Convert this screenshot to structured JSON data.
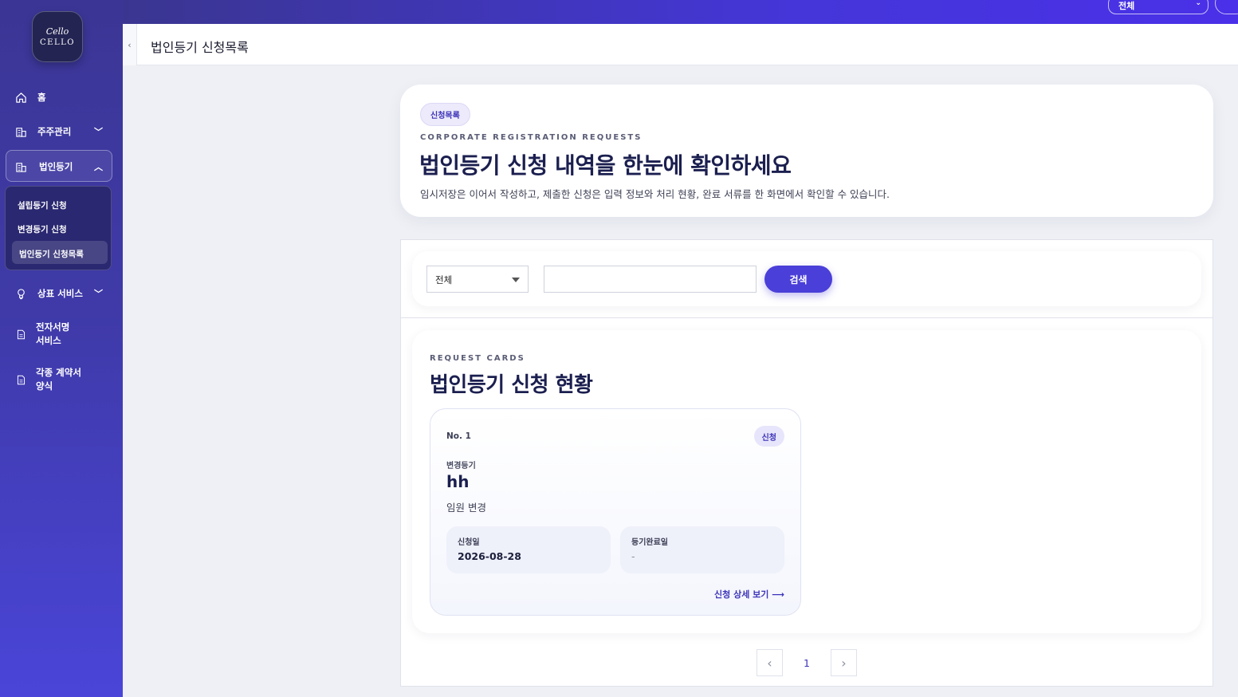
{
  "logo": {
    "mark": "Cello",
    "word": "CELLO"
  },
  "sidebar": {
    "items": [
      {
        "label": "홈",
        "icon": "home-icon"
      },
      {
        "label": "주주관리",
        "icon": "building-icon",
        "chevron": "﹀"
      },
      {
        "label": "법인등기",
        "icon": "building-icon",
        "chevron": "︿"
      },
      {
        "label": "상표 서비스",
        "icon": "lightbulb-icon",
        "chevron": "﹀"
      },
      {
        "label": "전자서명\n서비스",
        "icon": "document-icon"
      },
      {
        "label": "각종 계약서\n양식",
        "icon": "document-icon"
      }
    ],
    "submenu": [
      {
        "label": "설립등기 신청"
      },
      {
        "label": "변경등기 신청"
      },
      {
        "label": "법인등기 신청목록"
      }
    ]
  },
  "topbar": {
    "select_value": "전체"
  },
  "header": {
    "collapse": "‹",
    "title": "법인등기 신청목록"
  },
  "hero": {
    "pill": "신청목록",
    "eyebrow": "CORPORATE REGISTRATION REQUESTS",
    "title": "법인등기 신청 내역을 한눈에 확인하세요",
    "desc": "임시저장은 이어서 작성하고, 제출한 신청은 입력 정보와 처리 현황, 완료 서류를 한 화면에서 확인할 수 있습니다."
  },
  "search": {
    "select_value": "전체",
    "input_value": "",
    "button": "검색"
  },
  "cards": {
    "eyebrow": "REQUEST CARDS",
    "title": "법인등기 신청 현황",
    "items": [
      {
        "no": "No. 1",
        "badge": "신청",
        "type": "변경등기",
        "name": "hh",
        "sub": "임원 변경",
        "apply_label": "신청일",
        "apply_value": "2026-08-28",
        "done_label": "등기완료일",
        "done_value": "-",
        "link": "신청 상세 보기 ⟶"
      }
    ]
  },
  "pagination": {
    "prev": "‹",
    "current": "1",
    "next": "›"
  },
  "colors": {
    "accent": "#4a3fd8",
    "sidebar": "#3f3aa8",
    "title": "#1b1f4f"
  }
}
